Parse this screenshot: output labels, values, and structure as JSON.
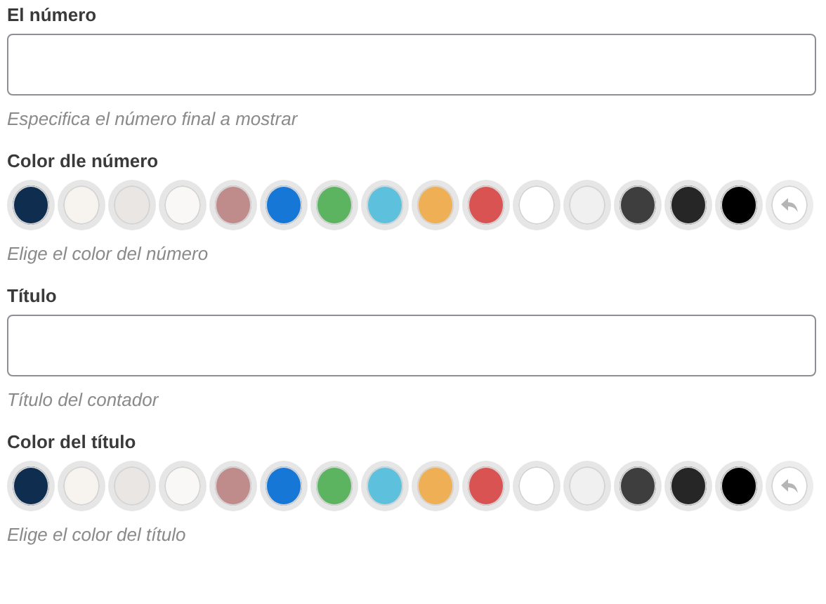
{
  "fields": [
    {
      "kind": "text",
      "label": "El número",
      "help": "Especifica el número final a mostrar"
    },
    {
      "kind": "color",
      "label": "Color dle número",
      "help": "Elige el color del número",
      "swatches": [
        {
          "color": "#0e2d4f"
        },
        {
          "color": "#f7f4f0"
        },
        {
          "color": "#e9e6e4"
        },
        {
          "color": "#f9f8f6"
        },
        {
          "color": "#bf8b8b"
        },
        {
          "color": "#1677d6"
        },
        {
          "color": "#5db460"
        },
        {
          "color": "#5dc0dd"
        },
        {
          "color": "#efaf54"
        },
        {
          "color": "#d95353"
        },
        {
          "color": "#ffffff"
        },
        {
          "color": "#f0f0f0"
        },
        {
          "color": "#3e3e3e"
        },
        {
          "color": "#262626"
        },
        {
          "color": "#000000"
        }
      ]
    },
    {
      "kind": "text",
      "label": "Título",
      "help": "Título del contador"
    },
    {
      "kind": "color",
      "label": "Color del título",
      "help": "Elige el color del título",
      "swatches": [
        {
          "color": "#0e2d4f"
        },
        {
          "color": "#f7f4f0"
        },
        {
          "color": "#e9e6e4"
        },
        {
          "color": "#f9f8f6"
        },
        {
          "color": "#bf8b8b"
        },
        {
          "color": "#1677d6"
        },
        {
          "color": "#5db460"
        },
        {
          "color": "#5dc0dd"
        },
        {
          "color": "#efaf54"
        },
        {
          "color": "#d95353"
        },
        {
          "color": "#ffffff"
        },
        {
          "color": "#f0f0f0"
        },
        {
          "color": "#3e3e3e"
        },
        {
          "color": "#262626"
        },
        {
          "color": "#000000"
        }
      ]
    }
  ]
}
